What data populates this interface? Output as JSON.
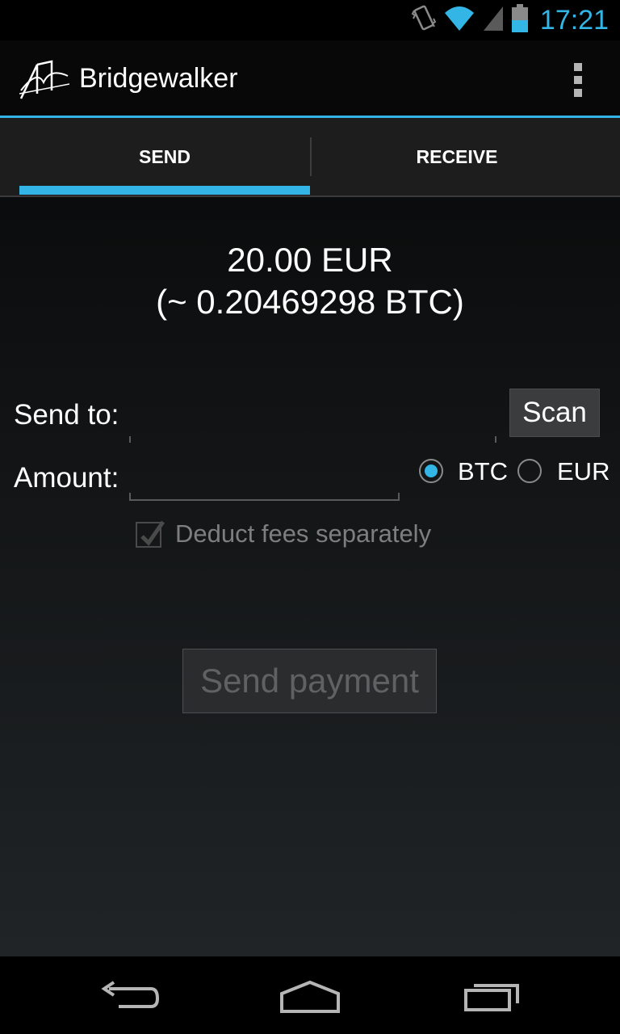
{
  "status_bar": {
    "time": "17:21",
    "icons": [
      "vibrate-icon",
      "wifi-icon",
      "signal-icon",
      "battery-icon"
    ]
  },
  "action_bar": {
    "title": "Bridgewalker",
    "logo_icon": "bridge-logo-icon",
    "overflow_icon": "overflow-menu-icon"
  },
  "tabs": [
    {
      "label": "SEND",
      "selected": true
    },
    {
      "label": "RECEIVE",
      "selected": false
    }
  ],
  "balance": {
    "primary": "20.00 EUR",
    "secondary": "(~ 0.20469298 BTC)"
  },
  "form": {
    "send_to_label": "Send to:",
    "send_to_value": "",
    "scan_label": "Scan",
    "amount_label": "Amount:",
    "amount_value": "",
    "currency_options": [
      {
        "label": "BTC",
        "checked": true
      },
      {
        "label": "EUR",
        "checked": false
      }
    ],
    "deduct_fees_label": "Deduct fees separately",
    "deduct_fees_checked": true,
    "send_button_label": "Send payment"
  },
  "nav_bar": {
    "icons": [
      "back-icon",
      "home-icon",
      "recents-icon"
    ]
  },
  "colors": {
    "accent": "#33b5e5",
    "background": "#000000"
  }
}
